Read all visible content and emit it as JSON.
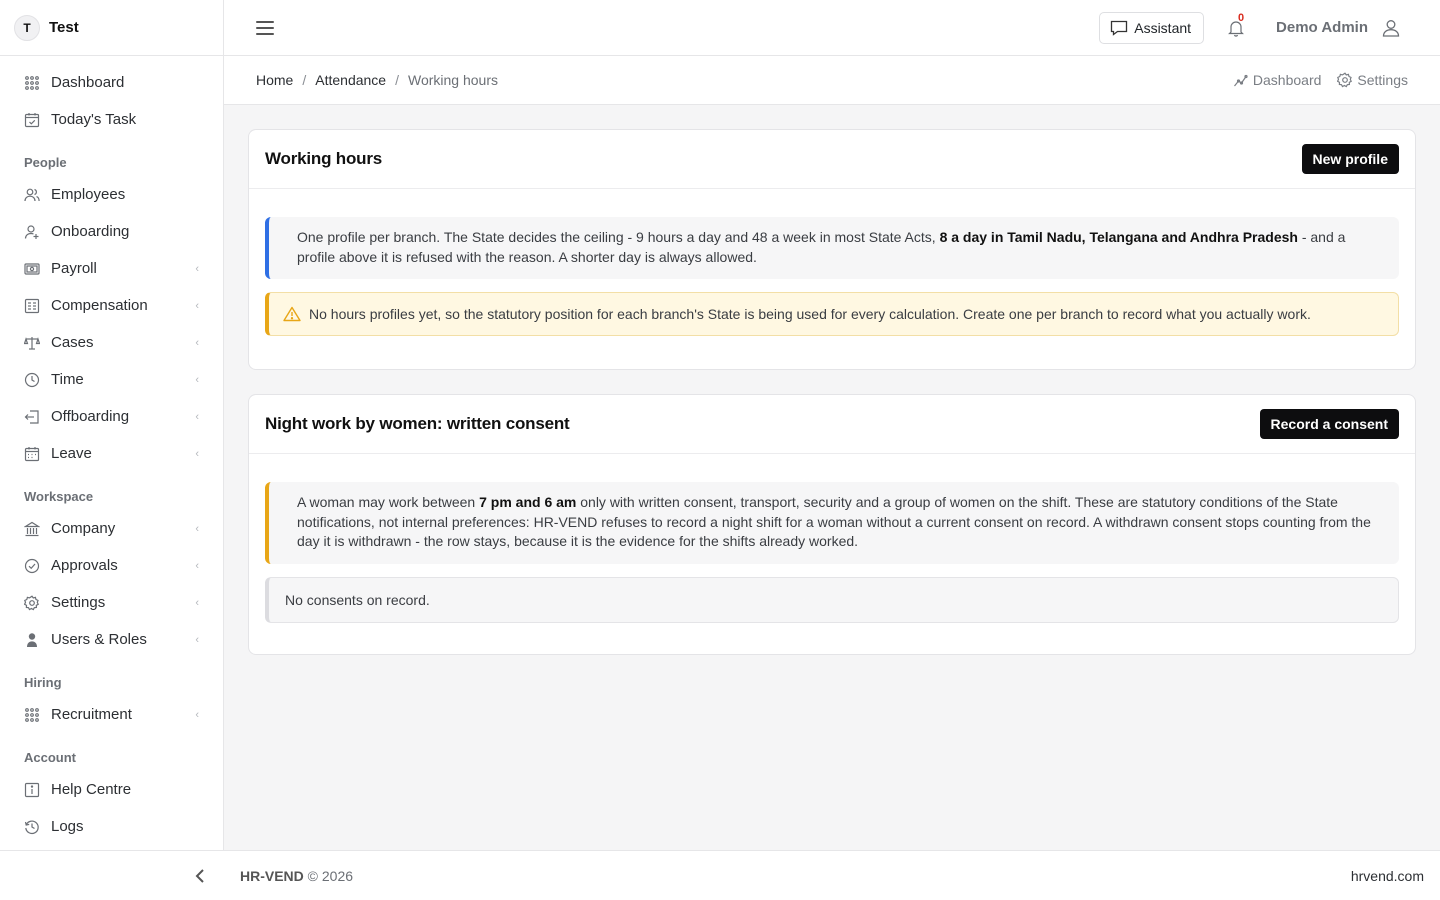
{
  "brand": {
    "initial": "T",
    "name": "Test"
  },
  "sidebar": {
    "top_items": [
      {
        "label": "Dashboard",
        "icon": "grid-icon"
      },
      {
        "label": "Today's Task",
        "icon": "calendar-check-icon"
      }
    ],
    "sections": {
      "people": "People",
      "workspace": "Workspace",
      "hiring": "Hiring",
      "account": "Account"
    },
    "people_items": [
      {
        "label": "Employees",
        "icon": "users-icon"
      },
      {
        "label": "Onboarding",
        "icon": "user-plus-icon"
      },
      {
        "label": "Payroll",
        "icon": "money-icon"
      },
      {
        "label": "Compensation",
        "icon": "ledger-icon"
      },
      {
        "label": "Cases",
        "icon": "scale-icon"
      },
      {
        "label": "Time",
        "icon": "clock-icon"
      },
      {
        "label": "Offboarding",
        "icon": "exit-icon"
      },
      {
        "label": "Leave",
        "icon": "calendar-icon"
      }
    ],
    "workspace_items": [
      {
        "label": "Company",
        "icon": "building-icon"
      },
      {
        "label": "Approvals",
        "icon": "check-circle-icon"
      },
      {
        "label": "Settings",
        "icon": "gear-icon"
      },
      {
        "label": "Users & Roles",
        "icon": "user-shield-icon"
      }
    ],
    "hiring_items": [
      {
        "label": "Recruitment",
        "icon": "grid-icon"
      }
    ],
    "account_items": [
      {
        "label": "Help Centre",
        "icon": "info-icon"
      },
      {
        "label": "Logs",
        "icon": "history-icon"
      }
    ],
    "expand_chevron": "‹"
  },
  "topbar": {
    "assistant_label": "Assistant",
    "notification_count": "0",
    "user_name": "Demo Admin"
  },
  "breadcrumb": {
    "home": "Home",
    "attendance": "Attendance",
    "current": "Working hours",
    "separator": "/"
  },
  "sub_actions": {
    "dashboard": "Dashboard",
    "settings": "Settings"
  },
  "working_hours": {
    "title": "Working hours",
    "new_profile_label": "New profile",
    "note_prefix": "One profile per branch. The State decides the ceiling - 9 hours a day and 48 a week in most State Acts, ",
    "note_bold": "8 a day in Tamil Nadu, Telangana and Andhra Pradesh",
    "note_suffix": " - and a profile above it is refused with the reason. A shorter day is always allowed.",
    "warning": "No hours profiles yet, so the statutory position for each branch's State is being used for every calculation. Create one per branch to record what you actually work."
  },
  "night_work": {
    "title": "Night work by women: written consent",
    "record_label": "Record a consent",
    "note_prefix": "A woman may work between ",
    "note_bold": "7 pm and 6 am",
    "note_suffix": " only with written consent, transport, security and a group of women on the shift. These are statutory conditions of the State notifications, not internal preferences: HR-VEND refuses to record a night shift for a woman without a current consent on record. A withdrawn consent stops counting from the day it is withdrawn - the row stays, because it is the evidence for the shifts already worked.",
    "empty_text": "No consents on record."
  },
  "footer": {
    "brand": "HR-VEND",
    "copyright": "© 2026",
    "site": "hrvend.com"
  },
  "colors": {
    "accent_blue": "#2f6fe4",
    "accent_amber": "#e8a617",
    "warning_bg": "#fff8e2",
    "badge_red": "#d92d20",
    "button_dark": "#0d0d0f"
  }
}
